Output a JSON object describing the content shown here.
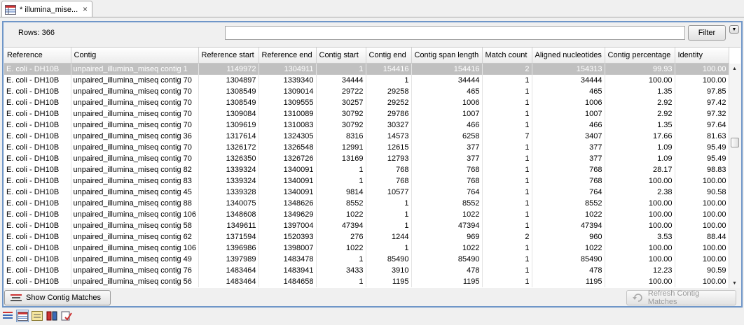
{
  "tab": {
    "label": "* illumina_mise...",
    "close": "×"
  },
  "header": {
    "rows_label": "Rows: 366",
    "filter_value": "",
    "filter_button": "Filter",
    "options_glyph": "▼"
  },
  "table": {
    "columns": [
      "Reference",
      "Contig",
      "Reference start",
      "Reference end",
      "Contig start",
      "Contig end",
      "Contig span length",
      "Match count",
      "Aligned nucleotides",
      "Contig percentage",
      "Identity"
    ],
    "rows": [
      [
        "E. coli - DH10B",
        "unpaired_illumina_miseq contig 1",
        "1149972",
        "1304911",
        "1",
        "154416",
        "154416",
        "2",
        "154313",
        "99.93",
        "100.00"
      ],
      [
        "E. coli - DH10B",
        "unpaired_illumina_miseq contig 70",
        "1304897",
        "1339340",
        "34444",
        "1",
        "34444",
        "1",
        "34444",
        "100.00",
        "100.00"
      ],
      [
        "E. coli - DH10B",
        "unpaired_illumina_miseq contig 70",
        "1308549",
        "1309014",
        "29722",
        "29258",
        "465",
        "1",
        "465",
        "1.35",
        "97.85"
      ],
      [
        "E. coli - DH10B",
        "unpaired_illumina_miseq contig 70",
        "1308549",
        "1309555",
        "30257",
        "29252",
        "1006",
        "1",
        "1006",
        "2.92",
        "97.42"
      ],
      [
        "E. coli - DH10B",
        "unpaired_illumina_miseq contig 70",
        "1309084",
        "1310089",
        "30792",
        "29786",
        "1007",
        "1",
        "1007",
        "2.92",
        "97.32"
      ],
      [
        "E. coli - DH10B",
        "unpaired_illumina_miseq contig 70",
        "1309619",
        "1310083",
        "30792",
        "30327",
        "466",
        "1",
        "466",
        "1.35",
        "97.64"
      ],
      [
        "E. coli - DH10B",
        "unpaired_illumina_miseq contig 36",
        "1317614",
        "1324305",
        "8316",
        "14573",
        "6258",
        "7",
        "3407",
        "17.66",
        "81.63"
      ],
      [
        "E. coli - DH10B",
        "unpaired_illumina_miseq contig 70",
        "1326172",
        "1326548",
        "12991",
        "12615",
        "377",
        "1",
        "377",
        "1.09",
        "95.49"
      ],
      [
        "E. coli - DH10B",
        "unpaired_illumina_miseq contig 70",
        "1326350",
        "1326726",
        "13169",
        "12793",
        "377",
        "1",
        "377",
        "1.09",
        "95.49"
      ],
      [
        "E. coli - DH10B",
        "unpaired_illumina_miseq contig 82",
        "1339324",
        "1340091",
        "1",
        "768",
        "768",
        "1",
        "768",
        "28.17",
        "98.83"
      ],
      [
        "E. coli - DH10B",
        "unpaired_illumina_miseq contig 83",
        "1339324",
        "1340091",
        "1",
        "768",
        "768",
        "1",
        "768",
        "100.00",
        "100.00"
      ],
      [
        "E. coli - DH10B",
        "unpaired_illumina_miseq contig 45",
        "1339328",
        "1340091",
        "9814",
        "10577",
        "764",
        "1",
        "764",
        "2.38",
        "90.58"
      ],
      [
        "E. coli - DH10B",
        "unpaired_illumina_miseq contig 88",
        "1340075",
        "1348626",
        "8552",
        "1",
        "8552",
        "1",
        "8552",
        "100.00",
        "100.00"
      ],
      [
        "E. coli - DH10B",
        "unpaired_illumina_miseq contig 106",
        "1348608",
        "1349629",
        "1022",
        "1",
        "1022",
        "1",
        "1022",
        "100.00",
        "100.00"
      ],
      [
        "E. coli - DH10B",
        "unpaired_illumina_miseq contig 58",
        "1349611",
        "1397004",
        "47394",
        "1",
        "47394",
        "1",
        "47394",
        "100.00",
        "100.00"
      ],
      [
        "E. coli - DH10B",
        "unpaired_illumina_miseq contig 62",
        "1371594",
        "1520393",
        "276",
        "1244",
        "969",
        "2",
        "960",
        "3.53",
        "88.44"
      ],
      [
        "E. coli - DH10B",
        "unpaired_illumina_miseq contig 106",
        "1396986",
        "1398007",
        "1022",
        "1",
        "1022",
        "1",
        "1022",
        "100.00",
        "100.00"
      ],
      [
        "E. coli - DH10B",
        "unpaired_illumina_miseq contig 49",
        "1397989",
        "1483478",
        "1",
        "85490",
        "85490",
        "1",
        "85490",
        "100.00",
        "100.00"
      ],
      [
        "E. coli - DH10B",
        "unpaired_illumina_miseq contig 76",
        "1483464",
        "1483941",
        "3433",
        "3910",
        "478",
        "1",
        "478",
        "12.23",
        "90.59"
      ],
      [
        "E. coli - DH10B",
        "unpaired_illumina_miseq contig 56",
        "1483464",
        "1484658",
        "1",
        "1195",
        "1195",
        "1",
        "1195",
        "100.00",
        "100.00"
      ]
    ],
    "selected_row": 0
  },
  "buttons": {
    "show_contig_matches": "Show Contig Matches",
    "refresh_contig_matches": "Refresh Contig Matches",
    "refresh_enabled": false
  },
  "toolbar": {
    "icons": [
      "table-view-icon",
      "graph-table-view-icon",
      "annotation-view-icon",
      "book-view-icon",
      "history-view-icon"
    ]
  },
  "colors": {
    "panel_border": "#6f96c8",
    "selected_row": "#c0c0c0",
    "background": "#f0f0f0"
  }
}
